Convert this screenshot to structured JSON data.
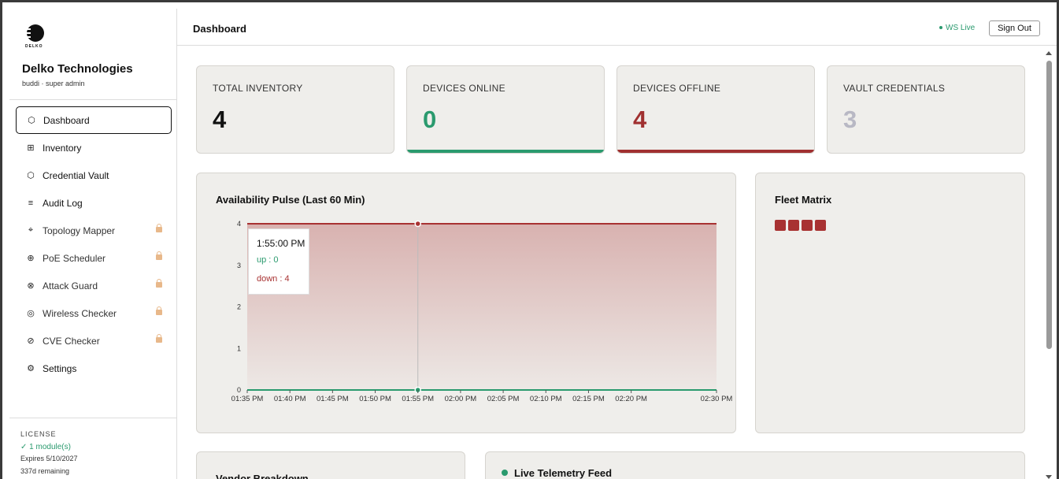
{
  "brand": {
    "logo_text": "DELKO",
    "name": "Delko Technologies",
    "user": "buddi · super admin"
  },
  "nav": [
    {
      "label": "Dashboard",
      "icon": "⬡",
      "active": true,
      "locked": false
    },
    {
      "label": "Inventory",
      "icon": "⊞",
      "active": false,
      "locked": false
    },
    {
      "label": "Credential Vault",
      "icon": "⬡",
      "active": false,
      "locked": false
    },
    {
      "label": "Audit Log",
      "icon": "≡",
      "active": false,
      "locked": false
    },
    {
      "label": "Topology Mapper",
      "icon": "⌖",
      "active": false,
      "locked": true
    },
    {
      "label": "PoE Scheduler",
      "icon": "⊕",
      "active": false,
      "locked": true
    },
    {
      "label": "Attack Guard",
      "icon": "⊗",
      "active": false,
      "locked": true
    },
    {
      "label": "Wireless Checker",
      "icon": "◎",
      "active": false,
      "locked": true
    },
    {
      "label": "CVE Checker",
      "icon": "⊘",
      "active": false,
      "locked": true
    },
    {
      "label": "Settings",
      "icon": "⚙",
      "active": false,
      "locked": false
    }
  ],
  "license": {
    "heading": "LICENSE",
    "modules": "✓ 1 module(s)",
    "expires": "Expires 5/10/2027",
    "remaining": "337d remaining"
  },
  "header": {
    "title": "Dashboard",
    "ws_status": "WS Live",
    "sign_out": "Sign Out"
  },
  "stats": [
    {
      "label": "TOTAL INVENTORY",
      "value": "4",
      "color": "#111111",
      "bar": null
    },
    {
      "label": "DEVICES ONLINE",
      "value": "0",
      "color": "#2a9a6e",
      "bar": "#2a9a6e"
    },
    {
      "label": "DEVICES OFFLINE",
      "value": "4",
      "color": "#a03030",
      "bar": "#a03030"
    },
    {
      "label": "VAULT CREDENTIALS",
      "value": "3",
      "color": "#b8b8c4",
      "bar": null
    }
  ],
  "availability": {
    "title": "Availability Pulse (Last 60 Min)",
    "tooltip": {
      "time": "1:55:00 PM",
      "up": "up : 0",
      "down": "down : 4"
    }
  },
  "fleet": {
    "title": "Fleet Matrix",
    "cells": [
      "#a83232",
      "#a83232",
      "#a83232",
      "#a83232"
    ]
  },
  "vendor": {
    "title": "Vendor Breakdown"
  },
  "telemetry": {
    "title": "Live Telemetry Feed"
  },
  "colors": {
    "up": "#2a9a6e",
    "down": "#a83232"
  },
  "chart_data": {
    "type": "area",
    "title": "Availability Pulse (Last 60 Min)",
    "x": [
      "01:35 PM",
      "01:40 PM",
      "01:45 PM",
      "01:50 PM",
      "01:55 PM",
      "02:00 PM",
      "02:05 PM",
      "02:10 PM",
      "02:15 PM",
      "02:20 PM",
      "02:30 PM"
    ],
    "x_minutes": [
      0,
      5,
      10,
      15,
      20,
      25,
      30,
      35,
      40,
      45,
      55
    ],
    "x_range_minutes": [
      0,
      55
    ],
    "yticks": [
      0,
      1,
      2,
      3,
      4
    ],
    "ylim": [
      0,
      4
    ],
    "series": [
      {
        "name": "up",
        "values": [
          0,
          0,
          0,
          0,
          0,
          0,
          0,
          0,
          0,
          0,
          0
        ]
      },
      {
        "name": "down",
        "values": [
          4,
          4,
          4,
          4,
          4,
          4,
          4,
          4,
          4,
          4,
          4
        ]
      }
    ],
    "active_index": 4,
    "grid": false
  }
}
